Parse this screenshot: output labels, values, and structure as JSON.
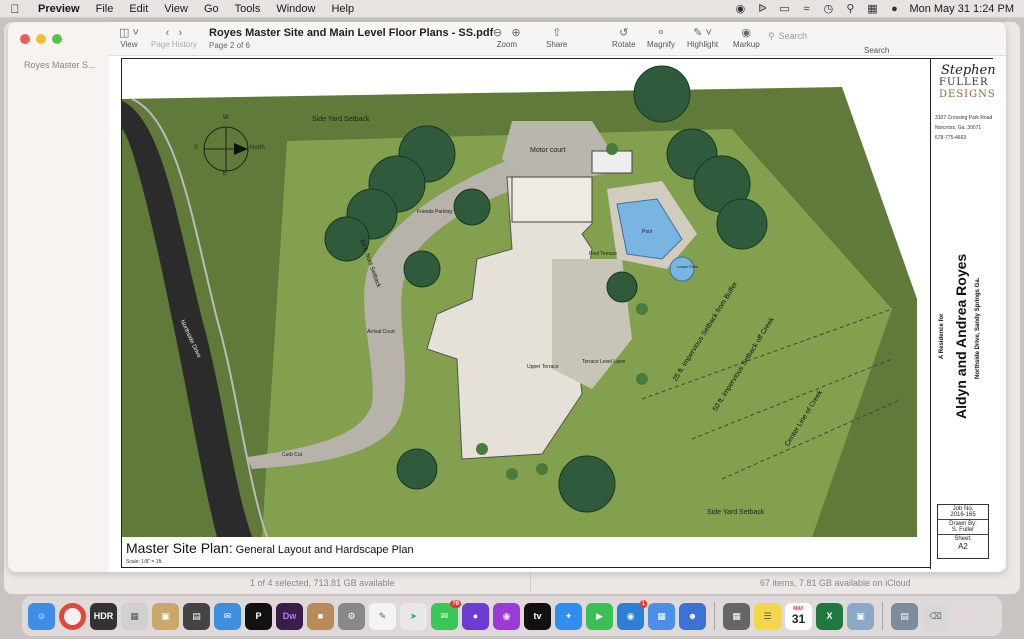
{
  "menubar": {
    "app_name": "Preview",
    "items": [
      "File",
      "Edit",
      "View",
      "Go",
      "Tools",
      "Window",
      "Help"
    ],
    "clock": "Mon May 31  1:24 PM"
  },
  "background_window": {
    "sidebar_label": "Royes Master S...",
    "status_left": "1 of 4 selected, 713.81 GB available",
    "status_right": "67 items, 7.81 GB available on iCloud"
  },
  "toolbar": {
    "title": "Royes Master Site and Main Level  Floor Plans - SS.pdf",
    "subtitle": "Page 2 of 6",
    "view_label": "View",
    "page_history_label": "Page History",
    "zoom_label": "Zoom",
    "share_label": "Share",
    "rotate_label": "Rotate",
    "magnify_label": "Magnify",
    "highlight_label": "Highlight",
    "markup_label": "Markup",
    "search_label": "Search",
    "search_placeholder": "Search"
  },
  "plan": {
    "labels": {
      "side_yard_top": "Side Yard Setback",
      "side_yard_bottom": "Side Yard Setback",
      "motor_court": "Motor court",
      "friends_parking": "Friends Parking",
      "front_setback": "60 ft. front Setback",
      "northside_drive": "Northside Drive",
      "arrival_court": "Arrival Court",
      "curb_cut": "Curb Cut",
      "pool": "Pool",
      "spa": "Lower Patio",
      "pool_terrace": "Pool Terrace",
      "terrace_lower_lawn": "Terrace Level Lawn",
      "upper_terrace": "Upper Terrace",
      "impervious_buffer": "25 ft. Impervious Setback from Buffer",
      "impervious_creek": "50 ft. Impervious Setback off Creek",
      "creek_line": "Center Line of Creek",
      "compass_w": "W",
      "compass_s": "S",
      "compass_e": "E",
      "compass_n": "North"
    },
    "title_main": "Master Site Plan:",
    "title_sub": " General Layout and Hardscape Plan",
    "scale": "Scale: 1/8\" = 1ft."
  },
  "title_block": {
    "logo_script": "Stephen",
    "logo_fuller": "FULLER",
    "logo_designs": "DESIGNS",
    "address": "3107 Crossing Park Road",
    "city": "Norcross, Ga. 30071",
    "phone": "678-775-4663",
    "residence_for": "A Residence for",
    "client_name": "Aldyn and Andrea Royes",
    "client_address": "Northside Drive, Sandy Springs Ga.",
    "job_no_label": "Job No.",
    "job_no": "2016-165",
    "drawn_by_label": "Drawn By:",
    "drawn_by": "S. Fuller",
    "sheet_label": "Sheet:",
    "sheet": "A2"
  },
  "dock": {
    "calendar_month": "MAY",
    "calendar_day": "31",
    "messages_badge": "70",
    "facetime_badge": "1",
    "hdr_label": "HDR",
    "dw_label": "Dw",
    "excel_label": "X",
    "tv_label": "tv"
  },
  "colors": {
    "grass": "#7f9a4c",
    "outer_grass": "#5f7a39",
    "paving": "#b9b6ad",
    "road": "#2b2b2b",
    "pool": "#78b5e3",
    "tree": "#2f5a3b"
  }
}
